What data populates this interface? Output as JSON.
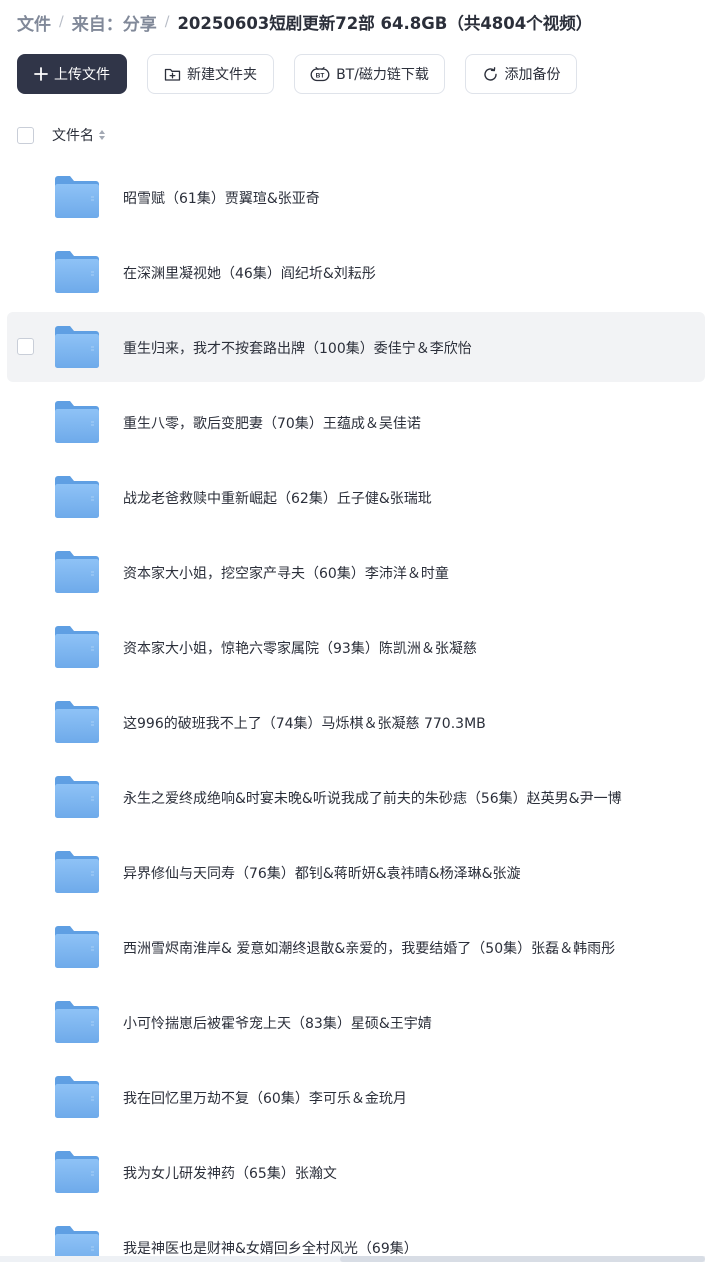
{
  "breadcrumb": {
    "root": "文件",
    "from": "来自：分享",
    "current": "20250603短剧更新72部 64.8GB（共4804个视频）",
    "separator": "/"
  },
  "toolbar": {
    "upload_label": "上传文件",
    "new_folder_label": "新建文件夹",
    "bt_label": "BT/磁力链下载",
    "backup_label": "添加备份"
  },
  "header": {
    "name_label": "文件名"
  },
  "icons": {
    "upload": "plus-icon",
    "new_folder": "folder-plus-icon",
    "bt": "bt-icon",
    "backup": "sync-icon",
    "sort": "sort-icon",
    "folder": "folder-icon"
  },
  "colors": {
    "primary_button": "#303548",
    "folder_blue": "#7fb5ef",
    "hover_row": "#f2f3f5"
  },
  "files": [
    {
      "name": "昭雪赋（61集）贾翼瑄&张亚奇"
    },
    {
      "name": "在深渊里凝视她（46集）阎纪圻&刘耘彤"
    },
    {
      "name": "重生归来，我才不按套路出牌（100集）委佳宁＆李欣怡"
    },
    {
      "name": "重生八零，歌后变肥妻（70集）王蕴成＆吴佳诺"
    },
    {
      "name": "战龙老爸救赎中重新崛起（62集）丘子健&张瑞玭"
    },
    {
      "name": "资本家大小姐，挖空家产寻夫（60集）李沛洋＆时童"
    },
    {
      "name": "资本家大小姐，惊艳六零家属院（93集）陈凯洲＆张凝慈"
    },
    {
      "name": "这996的破班我不上了（74集）马烁棋＆张凝慈 770.3MB"
    },
    {
      "name": "永生之爱终成绝响&时宴未晚&听说我成了前夫的朱砂痣（56集）赵英男&尹一博"
    },
    {
      "name": "异界修仙与天同寿（76集）都钊&蒋昕妍&袁祎晴&杨泽琳&张漩"
    },
    {
      "name": "西洲雪烬南淮岸& 爱意如潮终退散&亲爱的，我要结婚了（50集）张磊＆韩雨彤"
    },
    {
      "name": "小可怜揣崽后被霍爷宠上天（83集）星硕&王宇婧"
    },
    {
      "name": "我在回忆里万劫不复（60集）李可乐＆金玧月"
    },
    {
      "name": "我为女儿研发神药（65集）张瀚文"
    },
    {
      "name": "我是神医也是财神&女婿回乡全村风光（69集）"
    }
  ]
}
